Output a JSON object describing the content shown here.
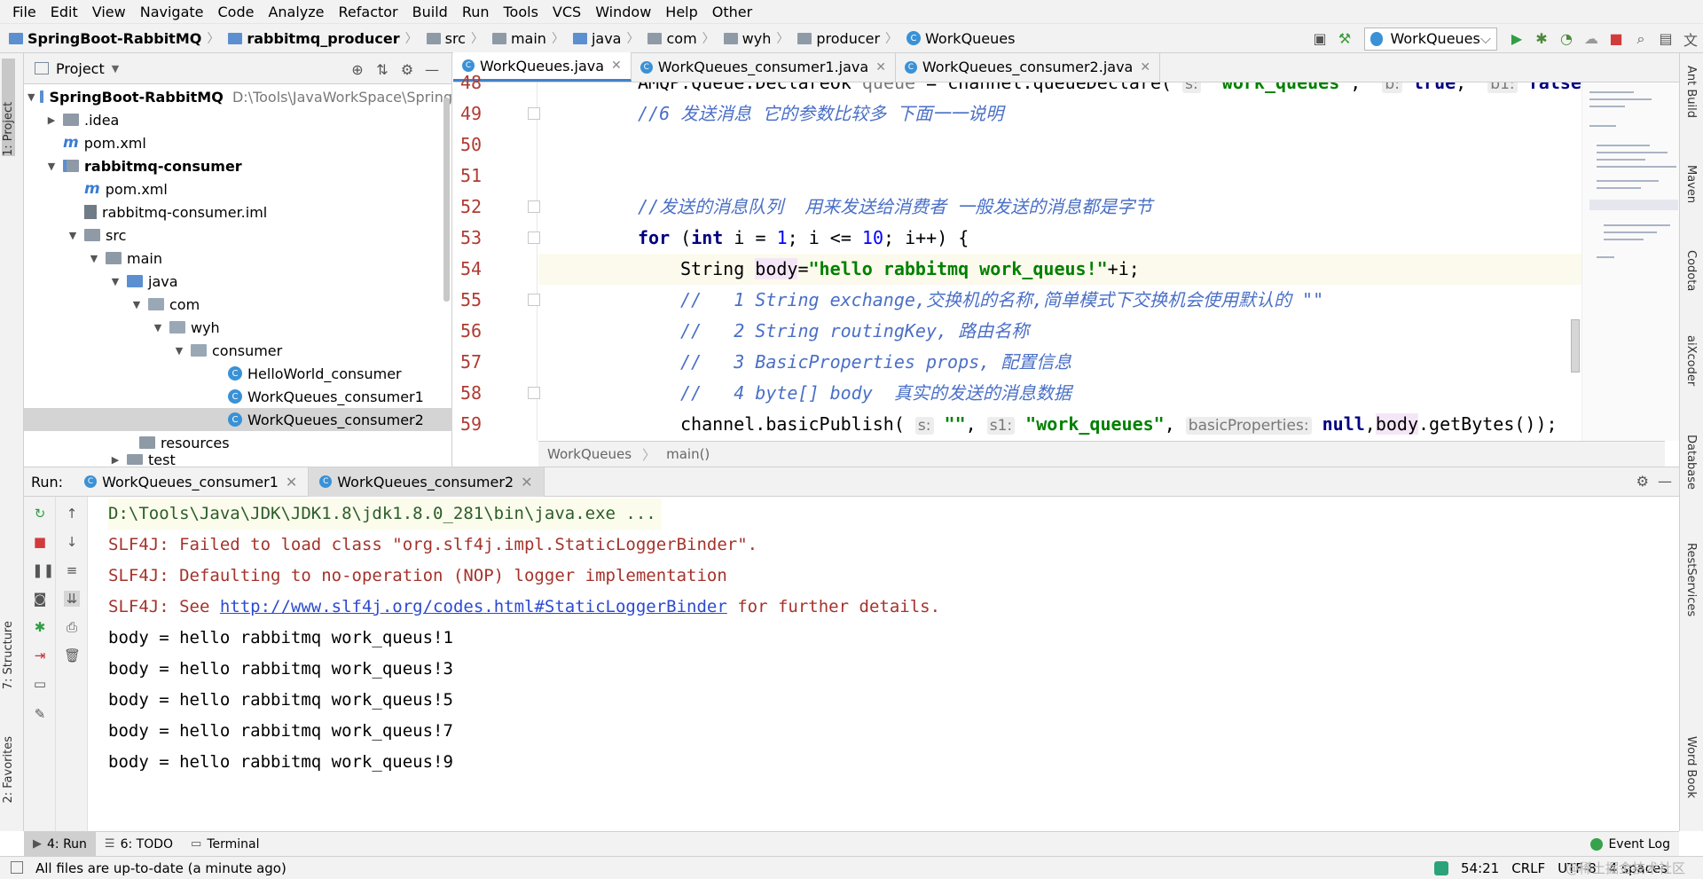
{
  "menu": [
    "File",
    "Edit",
    "View",
    "Navigate",
    "Code",
    "Analyze",
    "Refactor",
    "Build",
    "Run",
    "Tools",
    "VCS",
    "Window",
    "Help",
    "Other"
  ],
  "breadcrumb": [
    "SpringBoot-RabbitMQ",
    "rabbitmq_producer",
    "src",
    "main",
    "java",
    "com",
    "wyh",
    "producer",
    "WorkQueues"
  ],
  "run_config": "WorkQueues",
  "left_strip": {
    "project": "1: Project",
    "structure": "7: Structure",
    "favorites": "2: Favorites"
  },
  "right_strip": [
    "Ant Build",
    "Maven",
    "Codota",
    "aiXcoder",
    "Database",
    "RestServices",
    "Word Book"
  ],
  "project": {
    "title": "Project",
    "tree": [
      {
        "label": "SpringBoot-RabbitMQ",
        "extra": "D:\\Tools\\JavaWorkSpace\\SpringBoo"
      },
      {
        "label": ".idea"
      },
      {
        "label": "pom.xml"
      },
      {
        "label": "rabbitmq-consumer"
      },
      {
        "label": "pom.xml"
      },
      {
        "label": "rabbitmq-consumer.iml"
      },
      {
        "label": "src"
      },
      {
        "label": "main"
      },
      {
        "label": "java"
      },
      {
        "label": "com"
      },
      {
        "label": "wyh"
      },
      {
        "label": "consumer"
      },
      {
        "label": "HelloWorld_consumer"
      },
      {
        "label": "WorkQueues_consumer1"
      },
      {
        "label": "WorkQueues_consumer2"
      },
      {
        "label": "resources"
      },
      {
        "label": "test"
      }
    ]
  },
  "editor": {
    "tabs": [
      "WorkQueues.java",
      "WorkQueues_consumer1.java",
      "WorkQueues_consumer2.java"
    ],
    "line_numbers": [
      "48",
      "49",
      "50",
      "51",
      "52",
      "53",
      "54",
      "55",
      "56",
      "57",
      "58",
      "59"
    ],
    "code": {
      "l48_a": "AMQP.Queue.DeclareOk ",
      "l48_b": "queue",
      "l48_c": " = channel.queueDeclare( ",
      "l48_h1": "s:",
      "l48_s1": " \"work_queues\"",
      "l48_d": ",  ",
      "l48_h2": "b:",
      "l48_k1": " true",
      "l48_e": ",  ",
      "l48_h3": "b1:",
      "l48_k2": " false",
      "l48_f": ",",
      "l49": "//6 发送消息 它的参数比较多 下面一一说明",
      "l52": "//发送的消息队列  用来发送给消费者 一般发送的消息都是字节",
      "l53_kw": "for",
      "l53_a": " (",
      "l53_int": "int",
      "l53_b": " i = ",
      "l53_n1": "1",
      "l53_c": "; i <= ",
      "l53_n2": "10",
      "l53_d": "; i++) {",
      "l54_a": "String ",
      "l54_var": "body",
      "l54_b": "=",
      "l54_str": "\"hello rabbitmq work_queus!\"",
      "l54_c": "+i;",
      "l55": "//   1 String exchange,交换机的名称,简单模式下交换机会使用默认的 \"\"",
      "l56": "//   2 String routingKey, 路由名称",
      "l57": "//   3 BasicProperties props, 配置信息",
      "l58": "//   4 byte[] body  真实的发送的消息数据",
      "l59_a": "channel.basicPublish( ",
      "l59_h1": "s:",
      "l59_s1": " \"\"",
      "l59_b": ", ",
      "l59_h2": "s1:",
      "l59_s2": " \"work_queues\"",
      "l59_c": ", ",
      "l59_h3": "basicProperties:",
      "l59_k": " null",
      "l59_d": ",",
      "l59_var": "body",
      "l59_e": ".getBytes());"
    },
    "crumbs": [
      "WorkQueues",
      "main()"
    ]
  },
  "run": {
    "label": "Run:",
    "tabs": [
      "WorkQueues_consumer1",
      "WorkQueues_consumer2"
    ],
    "output": {
      "cmd": "D:\\Tools\\Java\\JDK\\JDK1.8\\jdk1.8.0_281\\bin\\java.exe ...",
      "err1": "SLF4J: Failed to load class \"org.slf4j.impl.StaticLoggerBinder\".",
      "err2": "SLF4J: Defaulting to no-operation (NOP) logger implementation",
      "err3_a": "SLF4J: See ",
      "err3_link": "http://www.slf4j.org/codes.html#StaticLoggerBinder",
      "err3_b": " for further details.",
      "lines": [
        "body = hello rabbitmq work_queus!1",
        "body = hello rabbitmq work_queus!3",
        "body = hello rabbitmq work_queus!5",
        "body = hello rabbitmq work_queus!7",
        "body = hello rabbitmq work_queus!9"
      ]
    }
  },
  "bottom_tabs": [
    "4: Run",
    "6: TODO",
    "Terminal"
  ],
  "event_log": "Event Log",
  "status": {
    "message": "All files are up-to-date (a minute ago)",
    "position": "54:21",
    "line_sep": "CRLF",
    "encoding": "UTF-8",
    "indent": "4 spaces"
  },
  "watermark": "@稀土掘金技术社区",
  "colors": {
    "accent": "#4083c9",
    "line_number": "#b03b33",
    "comment": "#4a6fc6",
    "string": "#008000",
    "keyword": "#000080",
    "error_text": "#a4332b"
  }
}
